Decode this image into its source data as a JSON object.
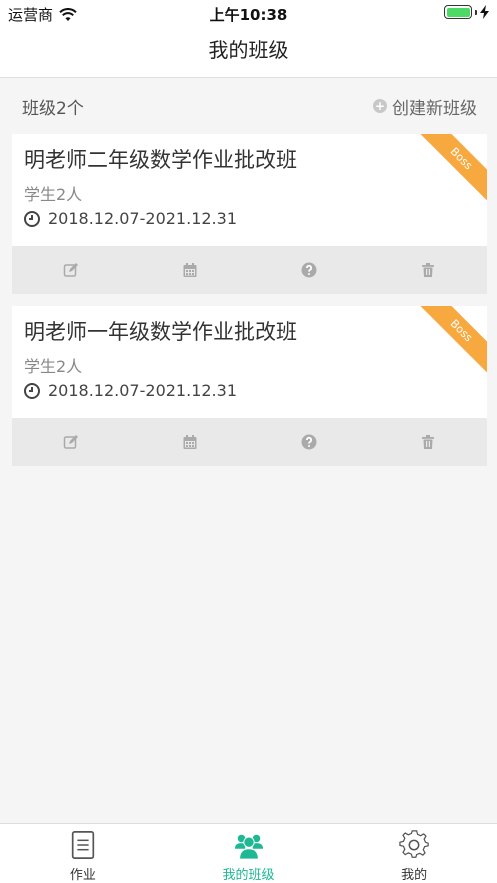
{
  "status_bar": {
    "carrier": "运营商",
    "time": "上午10:38"
  },
  "nav": {
    "title": "我的班级"
  },
  "summary": {
    "count_label": "班级2个",
    "create_label": "创建新班级"
  },
  "classes": [
    {
      "name": "明老师二年级数学作业批改班",
      "students": "学生2人",
      "date_range": "2018.12.07-2021.12.31",
      "badge": "Boss"
    },
    {
      "name": "明老师一年级数学作业批改班",
      "students": "学生2人",
      "date_range": "2018.12.07-2021.12.31",
      "badge": "Boss"
    }
  ],
  "card_actions": [
    "edit-icon",
    "calendar-icon",
    "help-icon",
    "trash-icon"
  ],
  "tabs": [
    {
      "label": "作业",
      "icon": "document-icon",
      "active": false
    },
    {
      "label": "我的班级",
      "icon": "class-group-icon",
      "active": true
    },
    {
      "label": "我的",
      "icon": "gear-icon",
      "active": false
    }
  ],
  "colors": {
    "accent": "#1fb894",
    "badge": "#f7a940",
    "action_bg": "#e9e9e9"
  }
}
